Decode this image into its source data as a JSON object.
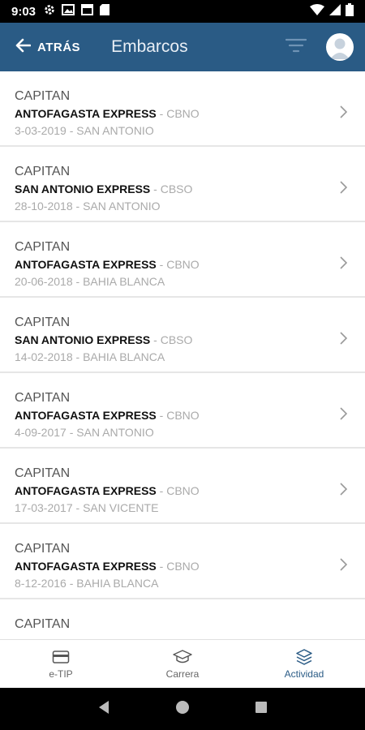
{
  "status_bar": {
    "time": "9:03"
  },
  "header": {
    "back_label": "ATRÁS",
    "title": "Embarcos"
  },
  "list": {
    "items": [
      {
        "role": "CAPITAN",
        "ship": "ANTOFAGASTA EXPRESS",
        "code": "CBNO",
        "date": "3-03-2019",
        "port": "SAN ANTONIO"
      },
      {
        "role": "CAPITAN",
        "ship": "SAN ANTONIO EXPRESS",
        "code": "CBSO",
        "date": "28-10-2018",
        "port": "SAN ANTONIO"
      },
      {
        "role": "CAPITAN",
        "ship": "ANTOFAGASTA EXPRESS",
        "code": "CBNO",
        "date": "20-06-2018",
        "port": "BAHIA BLANCA"
      },
      {
        "role": "CAPITAN",
        "ship": "SAN ANTONIO EXPRESS",
        "code": "CBSO",
        "date": "14-02-2018",
        "port": "BAHIA BLANCA"
      },
      {
        "role": "CAPITAN",
        "ship": "ANTOFAGASTA EXPRESS",
        "code": "CBNO",
        "date": "4-09-2017",
        "port": "SAN ANTONIO"
      },
      {
        "role": "CAPITAN",
        "ship": "ANTOFAGASTA EXPRESS",
        "code": "CBNO",
        "date": "17-03-2017",
        "port": "SAN VICENTE"
      },
      {
        "role": "CAPITAN",
        "ship": "ANTOFAGASTA EXPRESS",
        "code": "CBNO",
        "date": "8-12-2016",
        "port": "BAHIA BLANCA"
      },
      {
        "role": "CAPITAN",
        "ship": "",
        "code": "",
        "date": "",
        "port": ""
      }
    ],
    "separator": " - "
  },
  "bottom_nav": {
    "items": [
      {
        "label": "e-TIP",
        "icon": "card-icon",
        "active": false
      },
      {
        "label": "Carrera",
        "icon": "graduation-cap-icon",
        "active": false
      },
      {
        "label": "Actividad",
        "icon": "layers-icon",
        "active": true
      }
    ]
  },
  "colors": {
    "primary": "#2a5b85",
    "muted_text": "#aaaaaa",
    "active_nav": "#2a5b85"
  }
}
